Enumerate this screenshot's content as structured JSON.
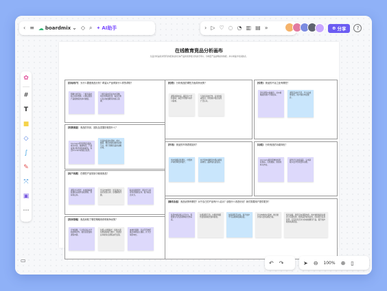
{
  "toolbar": {
    "app_name": "boardmix",
    "ai_label": "AI助手",
    "share_label": "分享",
    "zoom_level": "100%"
  },
  "colors": {
    "accent": "#6c5cf2",
    "note_purple": "#ddd9fb",
    "note_blue": "#c9e6fc",
    "note_gray": "#efefef"
  },
  "board": {
    "title": "在线教育竞品分析画布",
    "subtitle": "竞品分析是指对现有的或潜在的竞争产品的优势和劣势进行评价，为制定产品战略提供依据，并寻求差异化突破点。",
    "sections": {
      "target_users": {
        "head": "【目标用户】",
        "question": "为什么要做竞品分析？希望从产品得到什么样的帮助？",
        "notes": [
          "明确分析目标，了解竞品的核心用户群体，以便后续的产品规划提供参考依据。",
          "了解竞品的目标用户画像，用户的年龄层次、职业分布以及对在线教育的核心需求。"
        ]
      },
      "background": {
        "head": "【背景调查】",
        "question": "竞品的背景、团队及发展历程是什么？",
        "notes": [
          "Coursera背景调查竞品的成立时间、融资情况、产品发展过程及团队规模等。列出Coursera的核心优势。",
          "竞品的发展时间线：成立、融资、推出重要功能的关键节点，便于理解竞品的战略方向。"
        ]
      },
      "user_scenes": {
        "head": "【用户场景】",
        "question": "在哪些产品场景中使用竞品？",
        "notes": [
          "课程学习场景：在线观看视频课程完成作业和测验，并获得证书。",
          "学习社交场景：学员通过讨论区交流心得，互相解答问题。",
          "职业发展场景：通过学习获得专业技能证书，提升职业竞争力。"
        ]
      },
      "competitive": {
        "head": "【竞争策略】",
        "question": "竞品采取了哪些策略来获得竞争优势？",
        "notes": [
          "合作策略：与全球顶尖大学和机构合作，提供高质量的课程内容。",
          "免费+付费模式：提供大量免费课程吸引用户，再通过证书和专业课程进行变现。",
          "本地化策略：针对不同地区推出本地语言课程，扩大全球影响力。"
        ]
      },
      "advantages": {
        "head": "【优势】",
        "question": "分析竞品的哪些方面具有优势？",
        "notes": [
          "课程资源丰富，覆盖多个学科领域，满足不同用户的学习需求。",
          "与知名高校合作，证书的权威性高，得到用户和企业的广泛认可。"
        ]
      },
      "disadvantages": {
        "head": "【劣势】",
        "question": "竞品的不足之处有哪些？",
        "notes": [
          "部分课程价格偏高，对价格敏感的用户不够友好。",
          "课程互动性不足，学习完成率较低，用户容易中途放弃。"
        ]
      },
      "market": {
        "head": "【市场】",
        "question": "竞品的市场表现如何？",
        "notes": [
          "用户规模持续增长，付费用户转化率稳步提升。",
          "在全球在线教育市场占据领先地位，品牌知名度较高。"
        ]
      },
      "features": {
        "head": "【功能】",
        "question": "分析竞品的功能特色？",
        "notes": [
          "Coursera提供结构化的课程体系，包括视频、阅读材料与作业。",
          "提供学习进度追踪、证书获取以及学位项目等功能。"
        ]
      },
      "conclusion": {
        "head": "【最终总结】",
        "question": "竞品优势有哪些？对于自己的产品有什么启示？该做什么改进优化？我们需要用户提供更多？",
        "notes": [
          "优质内容是核心竞争力，需要建立与优质机构的合作关系。",
          "免费课程引流，付费增值服务变现的模式值得借鉴。",
          "加强课程互动性，提升用户学习完成率和满意度。",
          "针对本地用户需求，推出更具性价比的课程方案。",
          "综合来看，我们应在课程内容、用户体验和商业模式上持续优化，找准差异化的定位，同时结合自身优势，打造具有竞争力的在线教育产品，提升用户粘性和满意度。"
        ]
      }
    }
  }
}
